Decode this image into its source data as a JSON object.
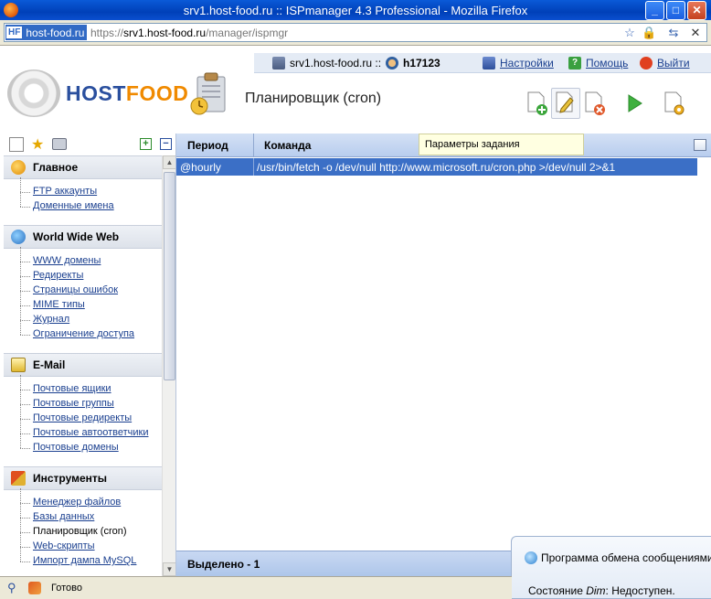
{
  "window": {
    "title": "srv1.host-food.ru :: ISPmanager 4.3 Professional - Mozilla Firefox",
    "min": "_",
    "max": "□",
    "close": "✕"
  },
  "address": {
    "site_badge": "HF",
    "site_name": "host-food.ru",
    "scheme": "https://",
    "host": "srv1.host-food.ru",
    "path": "/manager/ispmgr"
  },
  "header": {
    "server": "srv1.host-food.ru ::",
    "user": "h17123",
    "settings": "Настройки",
    "help": "Помощь",
    "logout": "Выйти",
    "logo_host": "HOST",
    "logo_food": "FOOD",
    "page_title": "Планировщик (cron)"
  },
  "colors": {
    "accent": "#3b6fc6",
    "link": "#1a3f8f",
    "logo_blue": "#2a4f9e",
    "logo_orange": "#f08a00"
  },
  "sidebar": {
    "sections": [
      {
        "title": "Главное",
        "items": [
          "FTP аккаунты",
          "Доменные имена"
        ]
      },
      {
        "title": "World Wide Web",
        "items": [
          "WWW домены",
          "Редиректы",
          "Страницы ошибок",
          "MIME типы",
          "Журнал",
          "Ограничение доступа"
        ]
      },
      {
        "title": "E-Mail",
        "items": [
          "Почтовые ящики",
          "Почтовые группы",
          "Почтовые редиректы",
          "Почтовые автоответчики",
          "Почтовые домены"
        ]
      },
      {
        "title": "Инструменты",
        "items": [
          "Менеджер файлов",
          "Базы данных",
          "Планировщик (cron)",
          "Web-скрипты",
          "Импорт дампа MySQL"
        ]
      }
    ]
  },
  "grid": {
    "columns": [
      "Период",
      "Команда"
    ],
    "rows": [
      {
        "period": "@hourly",
        "command": "/usr/bin/fetch -o /dev/null http://www.microsoft.ru/cron.php >/dev/null 2>&1"
      }
    ],
    "footer": "Выделено - 1",
    "tooltip": "Параметры задания"
  },
  "notification": {
    "title": "Программа обмена сообщениями",
    "status_prefix": "Состояние ",
    "status_user": "Dim",
    "status_suffix": ": Недоступен."
  },
  "statusbar": {
    "text": "Готово"
  }
}
